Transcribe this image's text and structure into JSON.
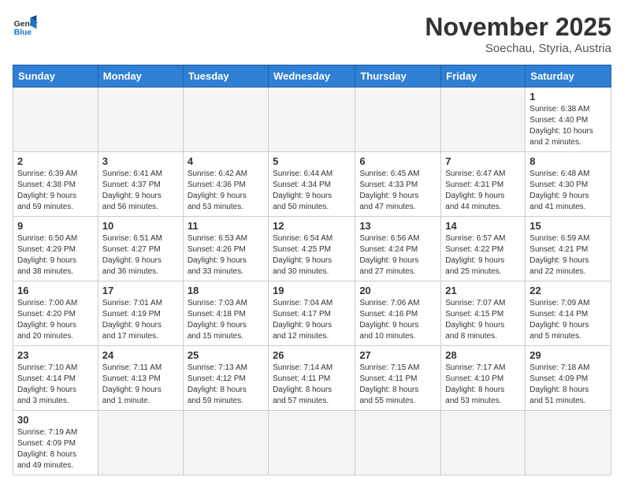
{
  "header": {
    "logo_general": "General",
    "logo_blue": "Blue",
    "month_year": "November 2025",
    "location": "Soechau, Styria, Austria"
  },
  "weekdays": [
    "Sunday",
    "Monday",
    "Tuesday",
    "Wednesday",
    "Thursday",
    "Friday",
    "Saturday"
  ],
  "weeks": [
    [
      {
        "day": "",
        "info": ""
      },
      {
        "day": "",
        "info": ""
      },
      {
        "day": "",
        "info": ""
      },
      {
        "day": "",
        "info": ""
      },
      {
        "day": "",
        "info": ""
      },
      {
        "day": "",
        "info": ""
      },
      {
        "day": "1",
        "info": "Sunrise: 6:38 AM\nSunset: 4:40 PM\nDaylight: 10 hours\nand 2 minutes."
      }
    ],
    [
      {
        "day": "2",
        "info": "Sunrise: 6:39 AM\nSunset: 4:38 PM\nDaylight: 9 hours\nand 59 minutes."
      },
      {
        "day": "3",
        "info": "Sunrise: 6:41 AM\nSunset: 4:37 PM\nDaylight: 9 hours\nand 56 minutes."
      },
      {
        "day": "4",
        "info": "Sunrise: 6:42 AM\nSunset: 4:36 PM\nDaylight: 9 hours\nand 53 minutes."
      },
      {
        "day": "5",
        "info": "Sunrise: 6:44 AM\nSunset: 4:34 PM\nDaylight: 9 hours\nand 50 minutes."
      },
      {
        "day": "6",
        "info": "Sunrise: 6:45 AM\nSunset: 4:33 PM\nDaylight: 9 hours\nand 47 minutes."
      },
      {
        "day": "7",
        "info": "Sunrise: 6:47 AM\nSunset: 4:31 PM\nDaylight: 9 hours\nand 44 minutes."
      },
      {
        "day": "8",
        "info": "Sunrise: 6:48 AM\nSunset: 4:30 PM\nDaylight: 9 hours\nand 41 minutes."
      }
    ],
    [
      {
        "day": "9",
        "info": "Sunrise: 6:50 AM\nSunset: 4:29 PM\nDaylight: 9 hours\nand 38 minutes."
      },
      {
        "day": "10",
        "info": "Sunrise: 6:51 AM\nSunset: 4:27 PM\nDaylight: 9 hours\nand 36 minutes."
      },
      {
        "day": "11",
        "info": "Sunrise: 6:53 AM\nSunset: 4:26 PM\nDaylight: 9 hours\nand 33 minutes."
      },
      {
        "day": "12",
        "info": "Sunrise: 6:54 AM\nSunset: 4:25 PM\nDaylight: 9 hours\nand 30 minutes."
      },
      {
        "day": "13",
        "info": "Sunrise: 6:56 AM\nSunset: 4:24 PM\nDaylight: 9 hours\nand 27 minutes."
      },
      {
        "day": "14",
        "info": "Sunrise: 6:57 AM\nSunset: 4:22 PM\nDaylight: 9 hours\nand 25 minutes."
      },
      {
        "day": "15",
        "info": "Sunrise: 6:59 AM\nSunset: 4:21 PM\nDaylight: 9 hours\nand 22 minutes."
      }
    ],
    [
      {
        "day": "16",
        "info": "Sunrise: 7:00 AM\nSunset: 4:20 PM\nDaylight: 9 hours\nand 20 minutes."
      },
      {
        "day": "17",
        "info": "Sunrise: 7:01 AM\nSunset: 4:19 PM\nDaylight: 9 hours\nand 17 minutes."
      },
      {
        "day": "18",
        "info": "Sunrise: 7:03 AM\nSunset: 4:18 PM\nDaylight: 9 hours\nand 15 minutes."
      },
      {
        "day": "19",
        "info": "Sunrise: 7:04 AM\nSunset: 4:17 PM\nDaylight: 9 hours\nand 12 minutes."
      },
      {
        "day": "20",
        "info": "Sunrise: 7:06 AM\nSunset: 4:16 PM\nDaylight: 9 hours\nand 10 minutes."
      },
      {
        "day": "21",
        "info": "Sunrise: 7:07 AM\nSunset: 4:15 PM\nDaylight: 9 hours\nand 8 minutes."
      },
      {
        "day": "22",
        "info": "Sunrise: 7:09 AM\nSunset: 4:14 PM\nDaylight: 9 hours\nand 5 minutes."
      }
    ],
    [
      {
        "day": "23",
        "info": "Sunrise: 7:10 AM\nSunset: 4:14 PM\nDaylight: 9 hours\nand 3 minutes."
      },
      {
        "day": "24",
        "info": "Sunrise: 7:11 AM\nSunset: 4:13 PM\nDaylight: 9 hours\nand 1 minute."
      },
      {
        "day": "25",
        "info": "Sunrise: 7:13 AM\nSunset: 4:12 PM\nDaylight: 8 hours\nand 59 minutes."
      },
      {
        "day": "26",
        "info": "Sunrise: 7:14 AM\nSunset: 4:11 PM\nDaylight: 8 hours\nand 57 minutes."
      },
      {
        "day": "27",
        "info": "Sunrise: 7:15 AM\nSunset: 4:11 PM\nDaylight: 8 hours\nand 55 minutes."
      },
      {
        "day": "28",
        "info": "Sunrise: 7:17 AM\nSunset: 4:10 PM\nDaylight: 8 hours\nand 53 minutes."
      },
      {
        "day": "29",
        "info": "Sunrise: 7:18 AM\nSunset: 4:09 PM\nDaylight: 8 hours\nand 51 minutes."
      }
    ],
    [
      {
        "day": "30",
        "info": "Sunrise: 7:19 AM\nSunset: 4:09 PM\nDaylight: 8 hours\nand 49 minutes."
      },
      {
        "day": "",
        "info": ""
      },
      {
        "day": "",
        "info": ""
      },
      {
        "day": "",
        "info": ""
      },
      {
        "day": "",
        "info": ""
      },
      {
        "day": "",
        "info": ""
      },
      {
        "day": "",
        "info": ""
      }
    ]
  ]
}
